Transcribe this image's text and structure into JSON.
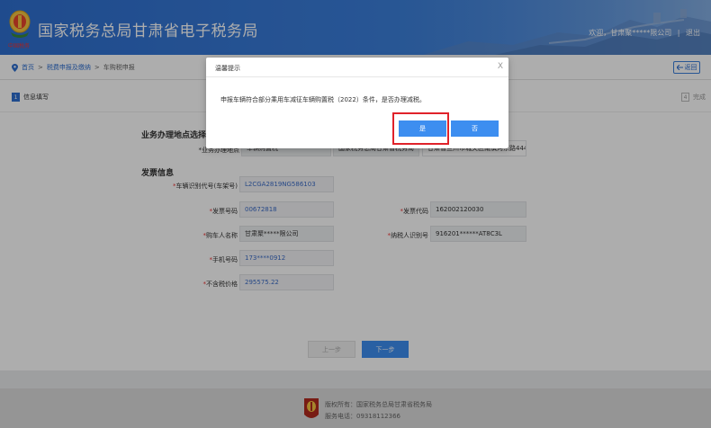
{
  "header": {
    "title": "国家税务总局甘肃省电子税务局",
    "logo_caption": "中国税务",
    "welcome": "欢迎，甘肃聚*****限公司",
    "separator": "|",
    "logout": "退出"
  },
  "breadcrumb": {
    "home": "首页",
    "sep1": ">",
    "level1": "税费申报及缴纳",
    "sep2": ">",
    "current": "车购税申报",
    "back_label": "返回"
  },
  "steps": {
    "first_num": "1",
    "first_label": "信息填写",
    "last_num": "4",
    "last_label": "完成"
  },
  "form": {
    "section_location": "业务办理地点选择",
    "location_label": "*业务办理地点",
    "location_value": "车辆购置税",
    "location_addr_value": "国家税务总局甘肃省税务局",
    "location_addr2": "甘肃省兰州市城关区南滨河东路444号",
    "section_invoice": "发票信息",
    "vin_label": "车辆识别代号(车架号)",
    "vin_value": "L2CGA2819NG586103",
    "invoice_no_label": "发票号码",
    "invoice_no_value": "00672818",
    "invoice_code_label": "发票代码",
    "invoice_code_value": "162002120030",
    "buyer_label": "购车人名称",
    "buyer_value": "甘肃聚*****限公司",
    "taxpayer_id_label": "纳税人识别号",
    "taxpayer_id_value": "916201******AT8C3L",
    "phone_label": "手机号码",
    "phone_value": "173****0912",
    "price_label": "不含税价格",
    "price_value": "295575.22",
    "required_mark": "*"
  },
  "buttons": {
    "prev": "上一步",
    "next": "下一步"
  },
  "dialog": {
    "title": "温馨提示",
    "close": "X",
    "message": "申报车辆符合部分乘用车减征车辆购置税（2022）条件，是否办理减税。",
    "yes": "是",
    "no": "否"
  },
  "footer": {
    "copyright": "版权所有：国家税务总局甘肃省税务局",
    "hotline": "服务电话：09318112366"
  },
  "colors": {
    "primary": "#3d8ef0",
    "header": "#2f6fd0",
    "highlight": "#e0222a"
  }
}
